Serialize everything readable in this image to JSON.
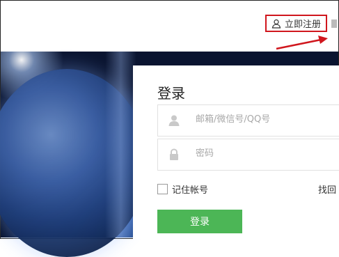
{
  "header": {
    "register_label": "立即注册"
  },
  "login": {
    "title": "登录",
    "username_placeholder": "邮箱/微信号/QQ号",
    "password_placeholder": "密码",
    "remember_label": "记住帐号",
    "forgot_label": "找回",
    "submit_label": "登录"
  },
  "colors": {
    "accent_green": "#4cb656",
    "highlight_red": "#d0161d"
  },
  "icons": [
    "user-icon",
    "lock-icon",
    "arrow-icon"
  ]
}
